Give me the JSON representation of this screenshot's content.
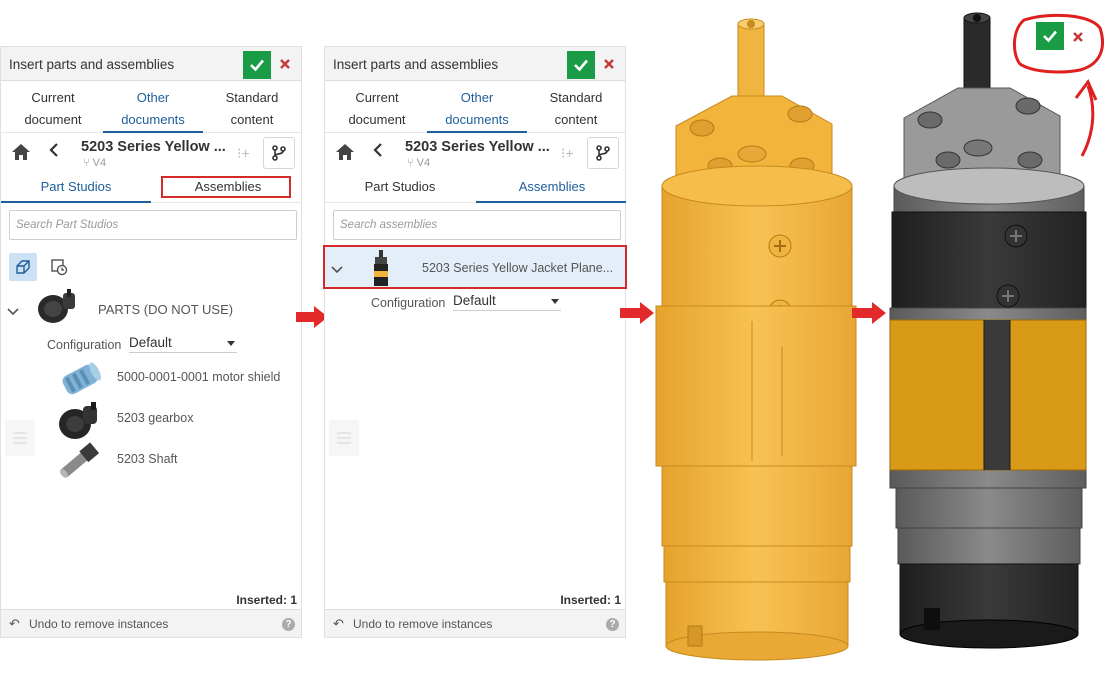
{
  "left_panel": {
    "title": "Insert parts and assemblies",
    "tabs": [
      {
        "line1": "Current",
        "line2": "document"
      },
      {
        "line1": "Other",
        "line2": "documents"
      },
      {
        "line1": "Standard",
        "line2": "content"
      }
    ],
    "document_name": "5203 Series Yellow ...",
    "document_version": "V4",
    "subtabs": [
      "Part Studios",
      "Assemblies"
    ],
    "search_placeholder": "Search Part Studios",
    "group_label": "PARTS (DO NOT USE)",
    "config_label": "Configuration",
    "config_value": "Default",
    "parts": [
      "5000-0001-0001 motor shield",
      "5203 gearbox",
      "5203 Shaft"
    ],
    "inserted": "Inserted: 1",
    "undo": "Undo to remove instances"
  },
  "mid_panel": {
    "title": "Insert parts and assemblies",
    "tabs": [
      {
        "line1": "Current",
        "line2": "document"
      },
      {
        "line1": "Other",
        "line2": "documents"
      },
      {
        "line1": "Standard",
        "line2": "content"
      }
    ],
    "document_name": "5203 Series Yellow ...",
    "document_version": "V4",
    "subtabs": [
      "Part Studios",
      "Assemblies"
    ],
    "search_placeholder": "Search assemblies",
    "assembly_label": "5203 Series Yellow Jacket Plane...",
    "config_label": "Configuration",
    "config_value": "Default",
    "inserted": "Inserted: 1",
    "undo": "Undo to remove instances"
  },
  "icons": {
    "confirm": "check-icon",
    "cancel": "close-icon",
    "home": "home-icon",
    "back": "chevron-left-icon",
    "branch": "branch-icon",
    "arrow": "red-right-arrow-icon"
  },
  "colors": {
    "accent": "#1f5e9c",
    "confirm_green": "#1a9b45",
    "cancel_red": "#c43a3a",
    "highlight_red": "#d42a2a",
    "motor_yellow": "#f2b43a",
    "motor_black": "#2b2b2b"
  }
}
